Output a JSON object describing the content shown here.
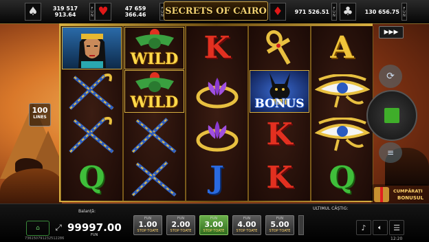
{
  "topbar": {
    "jackpots": [
      {
        "suit": "♠",
        "suit_icon": "spade-icon",
        "value": "319 517 913.64",
        "tag": "FUN"
      },
      {
        "suit": "♥",
        "suit_icon": "heart-icon",
        "value": "47 659 366.46",
        "tag": "FUN"
      },
      {
        "suit": "♦",
        "suit_icon": "diamond-icon",
        "value": "971 526.51",
        "tag": "FUN"
      },
      {
        "suit": "♣",
        "suit_icon": "club-icon",
        "value": "130 656.75",
        "tag": "FUN"
      }
    ],
    "title": "SECRETS OF CAIRO"
  },
  "reels": {
    "lines_count": "100",
    "lines_label": "LINES",
    "wild_label": "WILD",
    "bonus_label": "BONUS",
    "columns": [
      [
        "cleopatra",
        "wild",
        "staffs",
        "letter-q"
      ],
      [
        "wild",
        "wild",
        "staffs",
        "staffs"
      ],
      [
        "letter-k",
        "lotus-ring",
        "lotus-ring",
        "letter-j"
      ],
      [
        "ankh",
        "bonus-anubis",
        "letter-k",
        "letter-k"
      ],
      [
        "letter-a",
        "eye-of-horus",
        "eye-of-horus",
        "letter-q"
      ]
    ]
  },
  "letters": {
    "q": "Q",
    "k": "K",
    "j": "J",
    "a": "A"
  },
  "controls": {
    "fast_play": "▶▶▶",
    "gift_label_1": "CUMPĂRAȚI",
    "gift_label_2": "BONUSUL"
  },
  "bottom": {
    "balance_label": "Balanță:",
    "balance_value": "99997.00",
    "balance_currency": "FUN",
    "last_win_label": "ULTIMUL CÂȘTIG:",
    "bets": [
      {
        "tag": "FUN",
        "value": "1.00",
        "sub": "STOP TOATE",
        "selected": false
      },
      {
        "tag": "FUN",
        "value": "2.00",
        "sub": "STOP TOATE",
        "selected": false
      },
      {
        "tag": "FUN",
        "value": "3.00",
        "sub": "STOP TOATE",
        "selected": true
      },
      {
        "tag": "FUN",
        "value": "4.00",
        "sub": "STOP TOATE",
        "selected": false
      },
      {
        "tag": "FUN",
        "value": "5.00",
        "sub": "STOP TOATE",
        "selected": false
      }
    ],
    "session_id": "73615079123251228​6",
    "clock": "12:20"
  },
  "colors": {
    "accent_green": "#3fae2a",
    "gold": "#d8b040"
  }
}
